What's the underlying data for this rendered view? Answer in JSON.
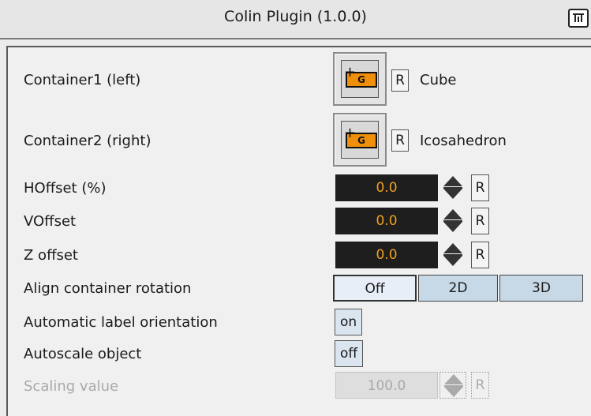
{
  "header": {
    "title": "Colin Plugin (1.0.0)",
    "icon": "plugin-info-icon"
  },
  "containers": [
    {
      "label": "Container1 (left)",
      "value": "Cube",
      "icon_text": "G",
      "reset_label": "R"
    },
    {
      "label": "Container2 (right)",
      "value": "Icosahedron",
      "icon_text": "G",
      "reset_label": "R"
    }
  ],
  "offsets": [
    {
      "label": "HOffset (%)",
      "value": "0.0",
      "reset_label": "R"
    },
    {
      "label": "VOffset",
      "value": "0.0",
      "reset_label": "R"
    },
    {
      "label": "Z offset",
      "value": "0.0",
      "reset_label": "R"
    }
  ],
  "align": {
    "label": "Align container rotation",
    "options": [
      "Off",
      "2D",
      "3D"
    ],
    "selected": "Off"
  },
  "auto_label": {
    "label": "Automatic label orientation",
    "value": "on"
  },
  "autoscale": {
    "label": "Autoscale object",
    "value": "off"
  },
  "scaling": {
    "label": "Scaling value",
    "value": "100.0",
    "reset_label": "R",
    "disabled": true
  },
  "colors": {
    "field_bg": "#1e1e1e",
    "field_text": "#f0a020",
    "icon_orange": "#f0900a",
    "seg_inactive": "#c7d8e6"
  }
}
